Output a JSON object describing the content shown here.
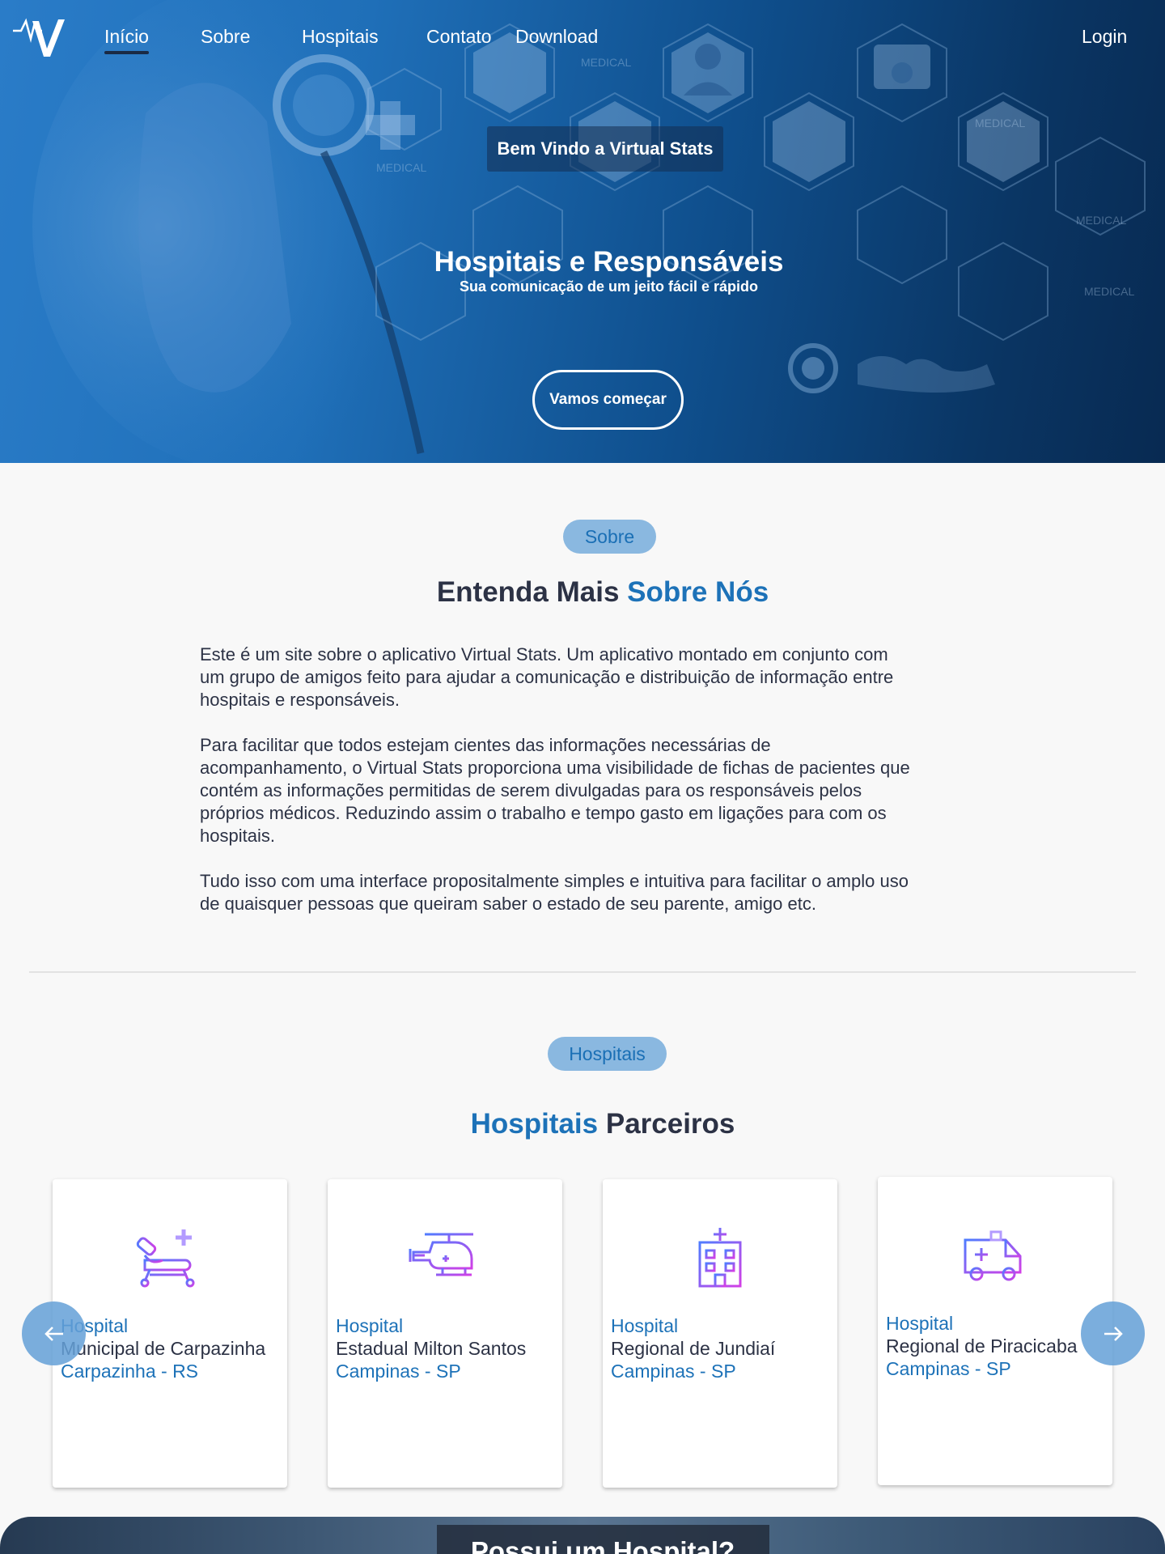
{
  "nav": {
    "links": [
      "Início",
      "Sobre",
      "Hospitais",
      "Contato",
      "Download"
    ],
    "login": "Login"
  },
  "hero": {
    "welcome": "Bem Vindo a Virtual Stats",
    "title": "Hospitais e Responsáveis",
    "subtitle": "Sua comunicação de um jeito fácil e rápido",
    "cta": "Vamos começar",
    "decor_labels": [
      "MEDICAL",
      "MEDICAL",
      "MEDICAL",
      "MEDICAL",
      "MEDICAL"
    ]
  },
  "about": {
    "pill": "Sobre",
    "title_part1": "Entenda Mais ",
    "title_part2": "Sobre Nós",
    "paragraphs": [
      "Este é um site sobre o aplicativo Virtual Stats. Um aplicativo montado em conjunto com um grupo de amigos feito para ajudar a comunicação e distribuição de informação entre hospitais e responsáveis.",
      "Para facilitar que todos estejam cientes das informações necessárias de acompanhamento, o Virtual Stats proporciona uma visibilidade de fichas de pacientes que contém as informações permitidas de serem divulgadas para os responsáveis pelos próprios médicos. Reduzindo assim o trabalho e tempo gasto em ligações para com os hospitais.",
      "Tudo isso com uma interface propositalmente simples e intuitiva para facilitar o amplo uso de quaisquer pessoas que queiram saber o estado de seu parente, amigo etc."
    ]
  },
  "hospitals": {
    "pill": "Hospitais",
    "title_part1": "Hospitais",
    "title_part2": " Parceiros",
    "cards": [
      {
        "line1": "Hospital",
        "line2": "Municipal de Carpazinha",
        "line3": "Carpazinha - RS",
        "icon": "hospital-bed-icon"
      },
      {
        "line1": "Hospital",
        "line2": "Estadual Milton Santos",
        "line3": "Campinas - SP",
        "icon": "helicopter-icon"
      },
      {
        "line1": "Hospital",
        "line2": "Regional de Jundiaí",
        "line3": "Campinas - SP",
        "icon": "hospital-building-icon"
      },
      {
        "line1": "Hospital",
        "line2": "Regional de Piracicaba",
        "line3": "Campinas - SP",
        "icon": "ambulance-icon"
      }
    ],
    "prev_icon": "arrow-left-icon",
    "next_icon": "arrow-right-icon"
  },
  "bottom": {
    "title": "Possui um Hospital?"
  },
  "colors": {
    "accent": "#1d72b8",
    "pill_bg": "#8ab8e0",
    "text": "#2c3245",
    "icon_gradient": [
      "#4f7cff",
      "#d23fe6"
    ]
  }
}
